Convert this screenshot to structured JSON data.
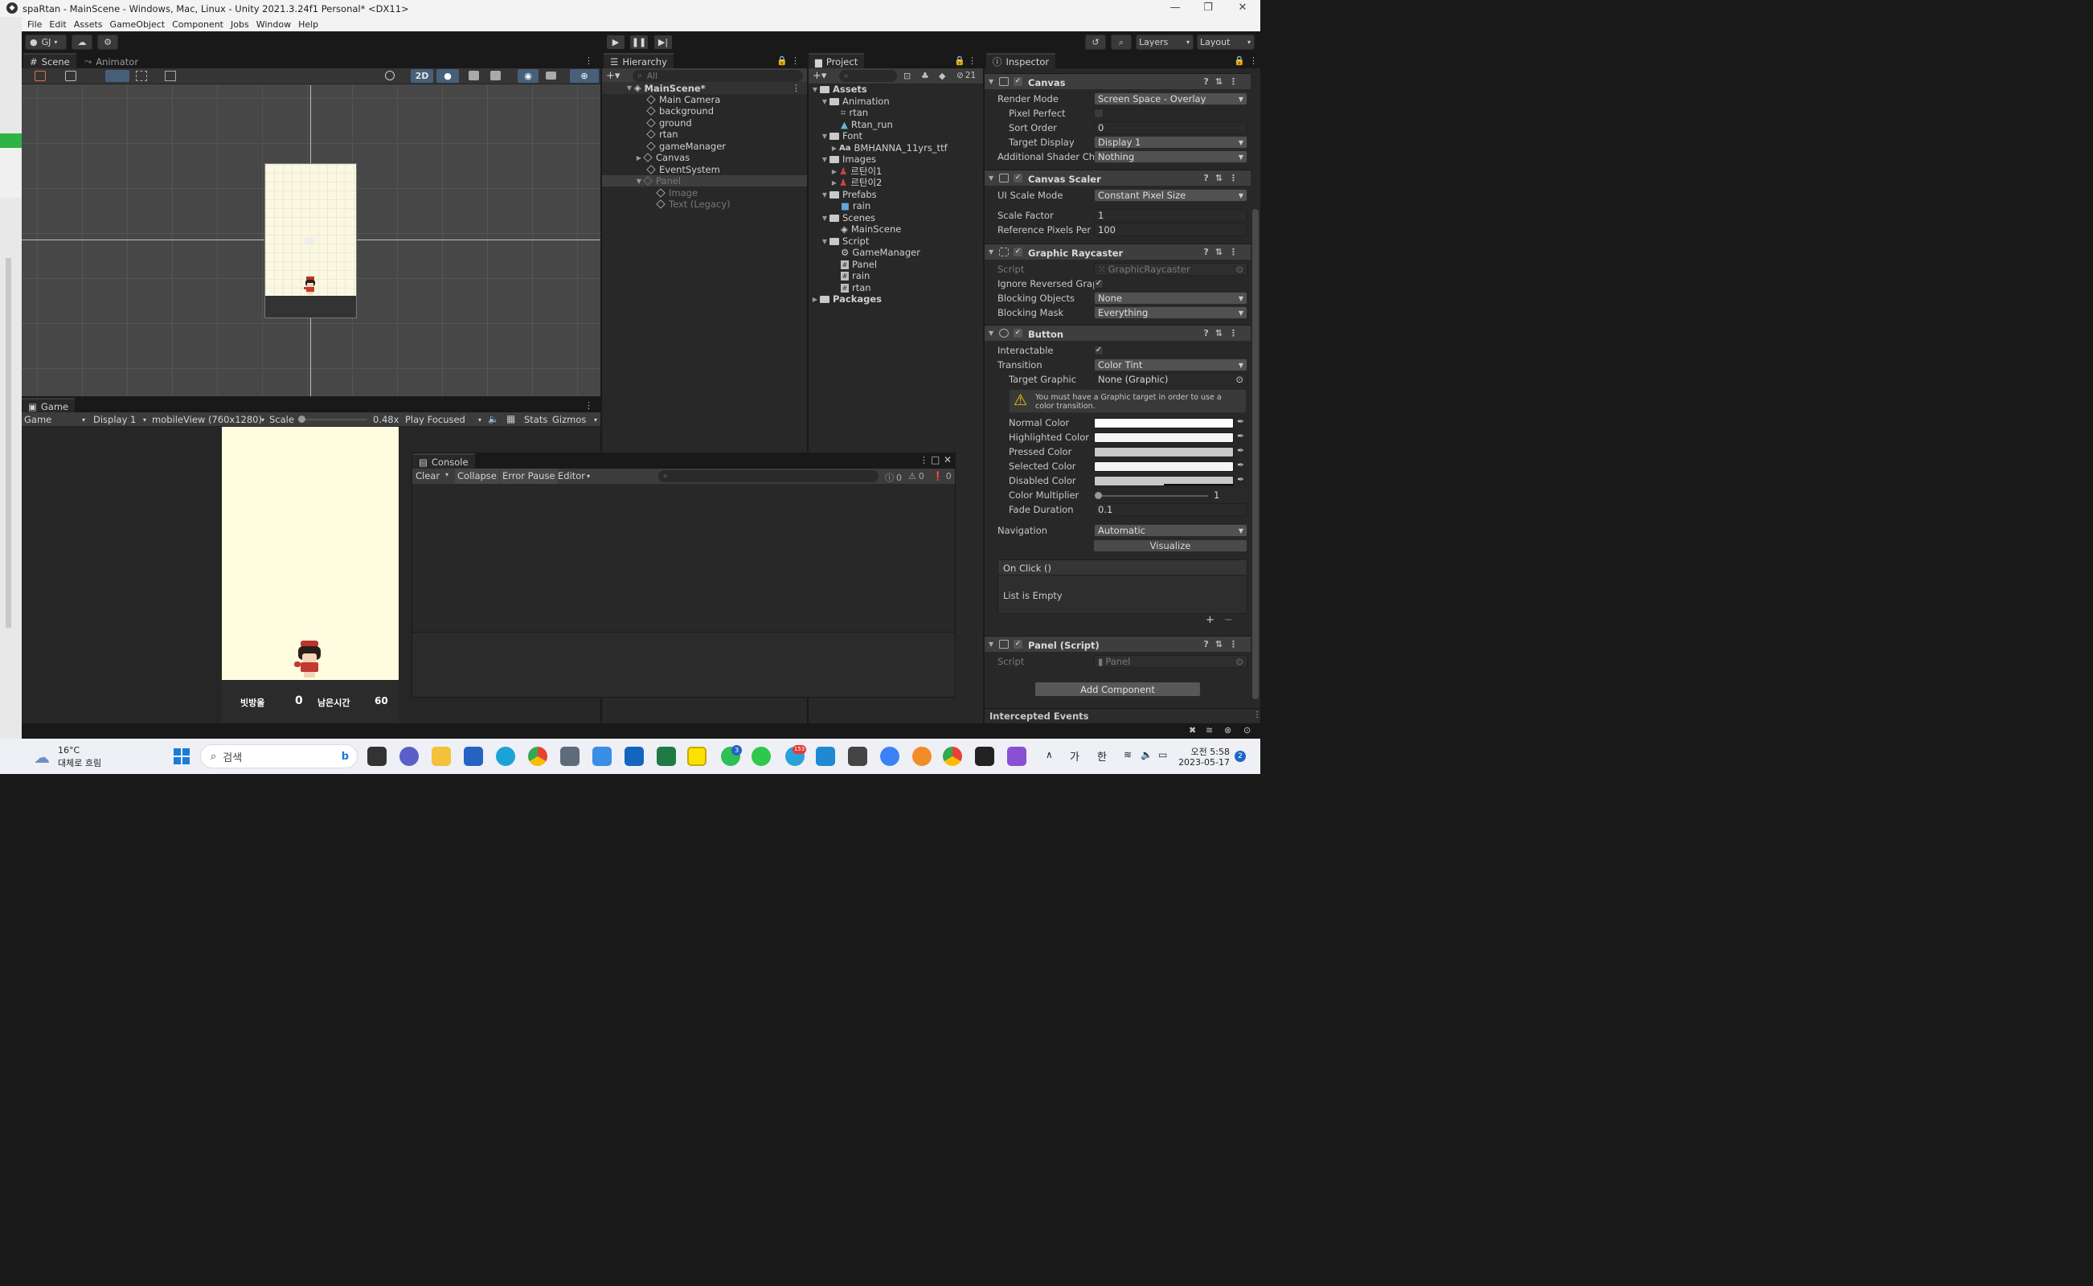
{
  "window": {
    "title": "spaRtan - MainScene - Windows, Mac, Linux - Unity 2021.3.24f1 Personal* <DX11>",
    "controls": [
      "—",
      "❐",
      "✕"
    ]
  },
  "menu": [
    "File",
    "Edit",
    "Assets",
    "GameObject",
    "Component",
    "Jobs",
    "Window",
    "Help"
  ],
  "toolbar": {
    "account": "GJ",
    "layers": "Layers",
    "layout": "Layout"
  },
  "scene_panel": {
    "tabs": [
      "Scene",
      "Animator"
    ],
    "btn_2d": "2D"
  },
  "game_panel": {
    "tab": "Game",
    "mode": "Game",
    "display": "Display 1",
    "resolution": "mobileView (760x1280)",
    "scale_label": "Scale",
    "scale_value": "0.48x",
    "play_mode": "Play Focused",
    "stats": "Stats",
    "gizmos": "Gizmos",
    "hud": {
      "drops_label": "빗방울",
      "drops_value": "0",
      "time_label": "남은시간",
      "time_value": "60"
    }
  },
  "console": {
    "title": "Console",
    "clear": "Clear",
    "collapse": "Collapse",
    "error_pause": "Error Pause",
    "editor": "Editor",
    "counts": [
      "0",
      "0",
      "0"
    ]
  },
  "hierarchy": {
    "tab": "Hierarchy",
    "search_placeholder": "All",
    "root": "MainScene*",
    "items": [
      {
        "label": "Main Camera",
        "dim": false
      },
      {
        "label": "background",
        "dim": false
      },
      {
        "label": "ground",
        "dim": false
      },
      {
        "label": "rtan",
        "dim": false
      },
      {
        "label": "gameManager",
        "dim": false
      },
      {
        "label": "Canvas",
        "dim": false
      },
      {
        "label": "EventSystem",
        "dim": false
      },
      {
        "label": "Panel",
        "dim": true
      },
      {
        "label": "Image",
        "dim": true
      },
      {
        "label": "Text (Legacy)",
        "dim": true
      }
    ]
  },
  "project": {
    "tab": "Project",
    "hidden_count": "21",
    "items": [
      {
        "label": "Assets"
      },
      {
        "label": "Animation"
      },
      {
        "label": "rtan"
      },
      {
        "label": "Rtan_run"
      },
      {
        "label": "Font"
      },
      {
        "label": "BMHANNA_11yrs_ttf"
      },
      {
        "label": "Images"
      },
      {
        "label": "르탄이1"
      },
      {
        "label": "르탄이2"
      },
      {
        "label": "Prefabs"
      },
      {
        "label": "rain"
      },
      {
        "label": "Scenes"
      },
      {
        "label": "MainScene"
      },
      {
        "label": "Script"
      },
      {
        "label": "GameManager"
      },
      {
        "label": "Panel"
      },
      {
        "label": "rain"
      },
      {
        "label": "rtan"
      },
      {
        "label": "Packages"
      }
    ]
  },
  "inspector": {
    "tab": "Inspector",
    "canvas": {
      "title": "Canvas",
      "render_mode_label": "Render Mode",
      "render_mode": "Screen Space - Overlay",
      "pixel_perfect_label": "Pixel Perfect",
      "sort_order_label": "Sort Order",
      "sort_order": "0",
      "target_display_label": "Target Display",
      "target_display": "Display 1",
      "shader_label": "Additional Shader Cha",
      "shader": "Nothing"
    },
    "scaler": {
      "title": "Canvas Scaler",
      "ui_scale_label": "UI Scale Mode",
      "ui_scale": "Constant Pixel Size",
      "scale_factor_label": "Scale Factor",
      "scale_factor": "1",
      "ref_pixels_label": "Reference Pixels Per U",
      "ref_pixels": "100"
    },
    "raycaster": {
      "title": "Graphic Raycaster",
      "script_label": "Script",
      "script": "GraphicRaycaster",
      "ignore_label": "Ignore Reversed Graph",
      "blocking_label": "Blocking Objects",
      "blocking": "None",
      "mask_label": "Blocking Mask",
      "mask": "Everything"
    },
    "button": {
      "title": "Button",
      "interactable_label": "Interactable",
      "transition_label": "Transition",
      "transition": "Color Tint",
      "target_label": "Target Graphic",
      "target": "None (Graphic)",
      "warning": "You must have a Graphic target in order to use a color transition.",
      "normal_label": "Normal Color",
      "highlighted_label": "Highlighted Color",
      "pressed_label": "Pressed Color",
      "selected_label": "Selected Color",
      "disabled_label": "Disabled Color",
      "multiplier_label": "Color Multiplier",
      "multiplier": "1",
      "fade_label": "Fade Duration",
      "fade": "0.1",
      "navigation_label": "Navigation",
      "navigation": "Automatic",
      "visualize": "Visualize",
      "onclick": "On Click ()",
      "list_empty": "List is Empty",
      "add": "+",
      "remove": "−"
    },
    "panel_script": {
      "title": "Panel (Script)",
      "script_label": "Script",
      "script": "Panel"
    },
    "add_component": "Add Component",
    "intercepted": "Intercepted Events"
  },
  "taskbar": {
    "weather_temp": "16°C",
    "weather_desc": "대체로 흐림",
    "search_placeholder": "검색",
    "time": "오전 5:58",
    "date": "2023-05-17",
    "ime_1": "가",
    "ime_2": "한",
    "notif_count": "2",
    "badge_whatsapp": "3",
    "badge_telegram": "153"
  },
  "colors": {
    "editor_bg": "#282828",
    "header_bg": "#191919",
    "game_bg": "#fffde0",
    "accent_select": "#2c5d87",
    "warning": "#f4c20d"
  }
}
